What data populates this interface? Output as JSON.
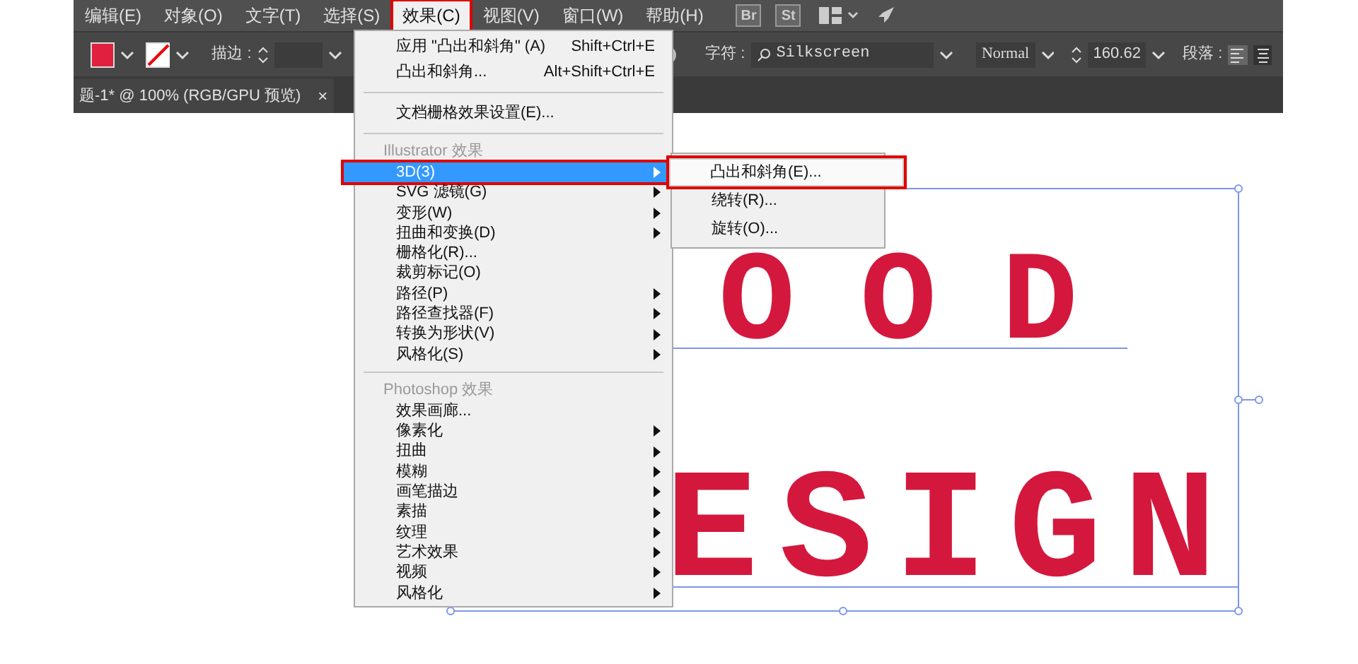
{
  "menu_bar": [
    {
      "label": "编辑(E)",
      "selected": false
    },
    {
      "label": "对象(O)",
      "selected": false
    },
    {
      "label": "文字(T)",
      "selected": false
    },
    {
      "label": "选择(S)",
      "selected": false
    },
    {
      "label": "效果(C)",
      "selected": true
    },
    {
      "label": "视图(V)",
      "selected": false
    },
    {
      "label": "窗口(W)",
      "selected": false
    },
    {
      "label": "帮助(H)",
      "selected": false
    }
  ],
  "app_icons": [
    "Br",
    "St"
  ],
  "control_bar": {
    "stroke_label": "描边 :",
    "character_label": "字符 :",
    "font": "Silkscreen",
    "font_style": "Normal",
    "font_size": "160.62",
    "paragraph_label": "段落 :"
  },
  "document_tab": {
    "title": "题-1* @ 100% (RGB/GPU 预览)",
    "close": "×"
  },
  "effect_menu": [
    {
      "kind": "item",
      "label": "应用 \"凸出和斜角\" (A)",
      "shortcut": "Shift+Ctrl+E",
      "submenu": false,
      "selected": false
    },
    {
      "kind": "item",
      "label": "凸出和斜角...",
      "shortcut": "Alt+Shift+Ctrl+E",
      "submenu": false,
      "selected": false
    },
    {
      "kind": "separator"
    },
    {
      "kind": "item",
      "label": "文档栅格效果设置(E)...",
      "submenu": false,
      "selected": false
    },
    {
      "kind": "separator"
    },
    {
      "kind": "header",
      "label": "Illustrator 效果"
    },
    {
      "kind": "item",
      "label": "3D(3)",
      "submenu": true,
      "selected": true
    },
    {
      "kind": "item",
      "label": "SVG 滤镜(G)",
      "submenu": true,
      "selected": false
    },
    {
      "kind": "item",
      "label": "变形(W)",
      "submenu": true,
      "selected": false
    },
    {
      "kind": "item",
      "label": "扭曲和变换(D)",
      "submenu": true,
      "selected": false
    },
    {
      "kind": "item",
      "label": "栅格化(R)...",
      "submenu": false,
      "selected": false
    },
    {
      "kind": "item",
      "label": "裁剪标记(O)",
      "submenu": false,
      "selected": false
    },
    {
      "kind": "item",
      "label": "路径(P)",
      "submenu": true,
      "selected": false
    },
    {
      "kind": "item",
      "label": "路径查找器(F)",
      "submenu": true,
      "selected": false
    },
    {
      "kind": "item",
      "label": "转换为形状(V)",
      "submenu": true,
      "selected": false
    },
    {
      "kind": "item",
      "label": "风格化(S)",
      "submenu": true,
      "selected": false
    },
    {
      "kind": "separator"
    },
    {
      "kind": "header",
      "label": "Photoshop 效果"
    },
    {
      "kind": "item",
      "label": "效果画廊...",
      "submenu": false,
      "selected": false
    },
    {
      "kind": "item",
      "label": "像素化",
      "submenu": true,
      "selected": false
    },
    {
      "kind": "item",
      "label": "扭曲",
      "submenu": true,
      "selected": false
    },
    {
      "kind": "item",
      "label": "模糊",
      "submenu": true,
      "selected": false
    },
    {
      "kind": "item",
      "label": "画笔描边",
      "submenu": true,
      "selected": false
    },
    {
      "kind": "item",
      "label": "素描",
      "submenu": true,
      "selected": false
    },
    {
      "kind": "item",
      "label": "纹理",
      "submenu": true,
      "selected": false
    },
    {
      "kind": "item",
      "label": "艺术效果",
      "submenu": true,
      "selected": false
    },
    {
      "kind": "item",
      "label": "视频",
      "submenu": true,
      "selected": false
    },
    {
      "kind": "item",
      "label": "风格化",
      "submenu": true,
      "selected": false
    }
  ],
  "submenu_3d": [
    {
      "label": "凸出和斜角(E)...",
      "highlighted": true
    },
    {
      "label": "绕转(R)...",
      "highlighted": false
    },
    {
      "label": "旋转(O)...",
      "highlighted": false
    }
  ],
  "canvas_text": [
    "OOD",
    "ESIGN"
  ]
}
